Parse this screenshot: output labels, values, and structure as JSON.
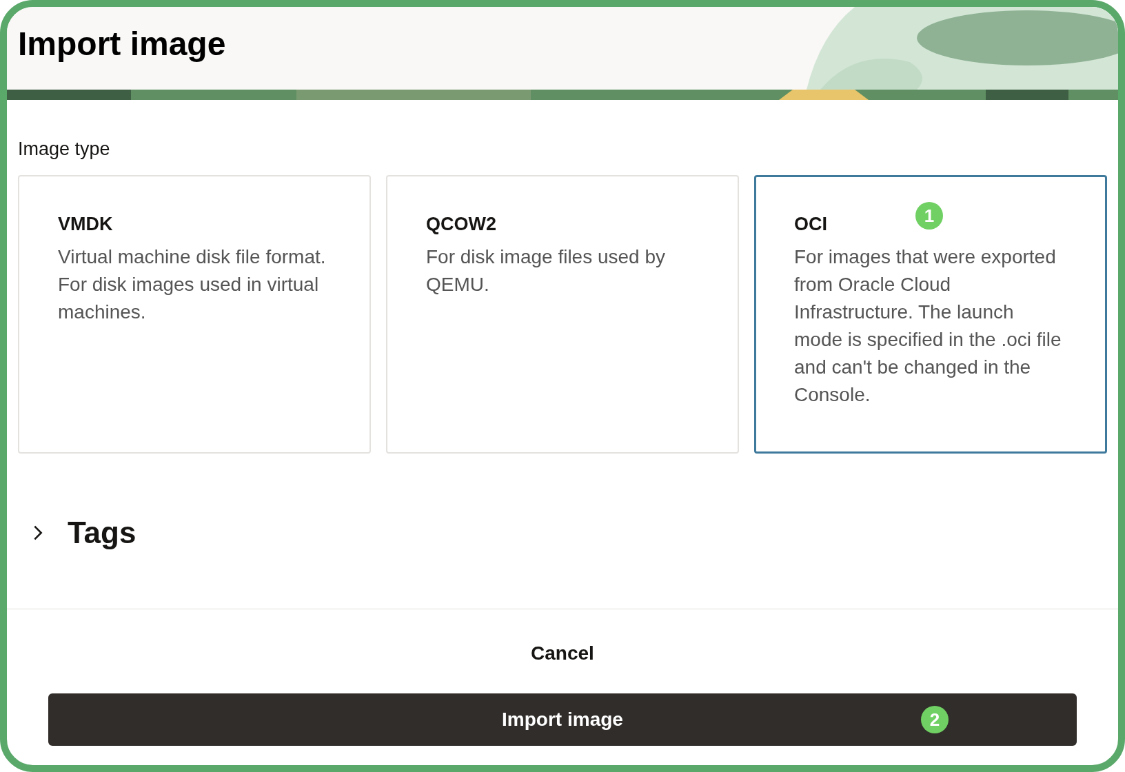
{
  "dialog": {
    "title": "Import image"
  },
  "image_type": {
    "label": "Image type",
    "options": [
      {
        "title": "VMDK",
        "description": "Virtual machine disk file format. For disk images used in virtual machines.",
        "selected": false
      },
      {
        "title": "QCOW2",
        "description": "For disk image files used by QEMU.",
        "selected": false
      },
      {
        "title": "OCI",
        "description": "For images that were exported from Oracle Cloud Infrastructure. The launch mode is specified in the .oci file and can't be changed in the Console.",
        "selected": true,
        "step_badge": "1"
      }
    ]
  },
  "tags_section": {
    "label": "Tags",
    "expanded": false
  },
  "footer": {
    "cancel": "Cancel",
    "primary": {
      "label": "Import image",
      "step_badge": "2"
    }
  }
}
